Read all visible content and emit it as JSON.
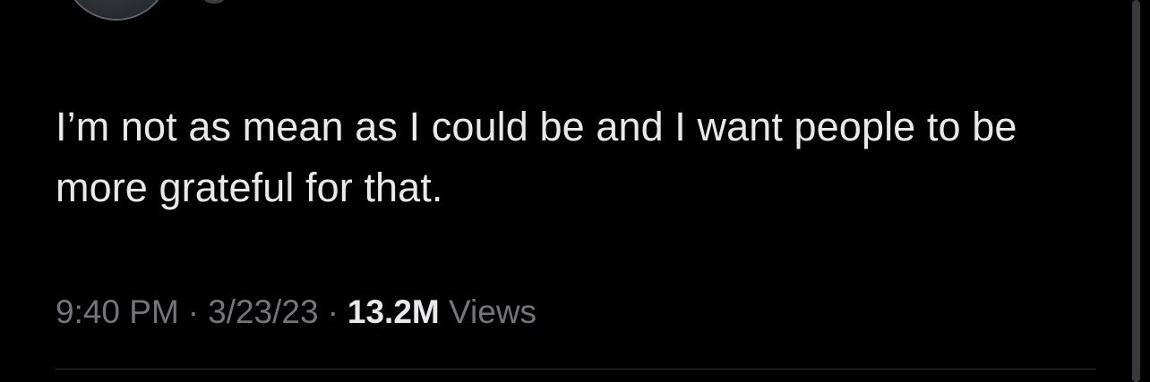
{
  "tweet": {
    "text": "I’m not as mean as I could be and I want people to be more grateful for that.",
    "time": "9:40 PM",
    "date": "3/23/23",
    "separator": "·",
    "views_count": "13.2M",
    "views_label": "Views"
  },
  "colors": {
    "background": "#000000",
    "text_primary": "#e7e9ea",
    "text_secondary": "#71767b",
    "divider": "#2f3336"
  }
}
